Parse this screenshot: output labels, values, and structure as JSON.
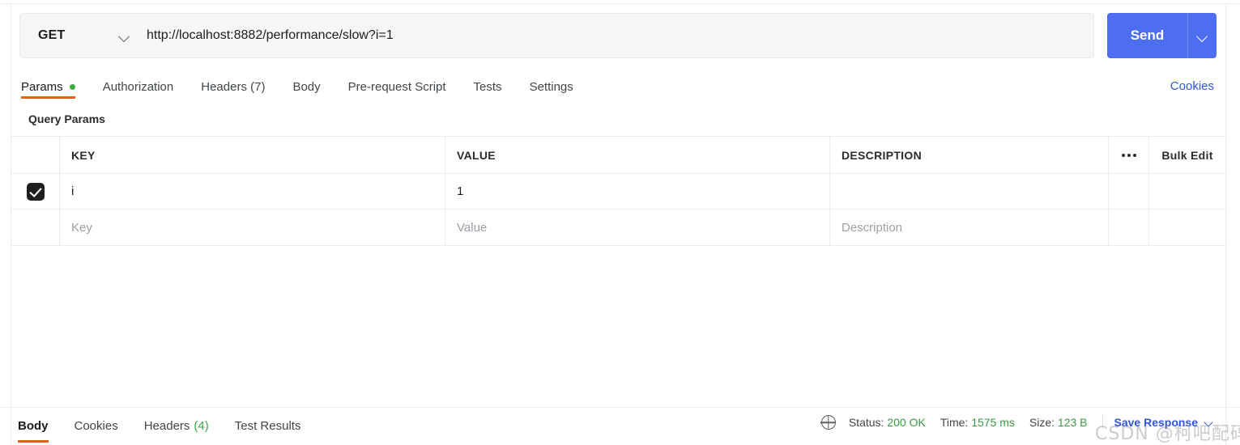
{
  "request": {
    "method": "GET",
    "url": "http://localhost:8882/performance/slow?i=1",
    "send_label": "Send",
    "send_caret_icon": "chevron-down-icon",
    "method_caret_icon": "chevron-down-icon"
  },
  "request_tabs": {
    "items": [
      {
        "label": "Params",
        "active": true,
        "has_dot": true
      },
      {
        "label": "Authorization",
        "active": false,
        "has_dot": false
      },
      {
        "label": "Headers (7)",
        "active": false,
        "has_dot": false
      },
      {
        "label": "Body",
        "active": false,
        "has_dot": false
      },
      {
        "label": "Pre-request Script",
        "active": false,
        "has_dot": false
      },
      {
        "label": "Tests",
        "active": false,
        "has_dot": false
      },
      {
        "label": "Settings",
        "active": false,
        "has_dot": false
      }
    ],
    "cookies_label": "Cookies"
  },
  "query_params": {
    "section_title": "Query Params",
    "columns": {
      "key": "KEY",
      "value": "VALUE",
      "description": "DESCRIPTION"
    },
    "more_icon": "ellipsis-icon",
    "bulk_edit_label": "Bulk Edit",
    "rows": [
      {
        "checked": true,
        "key": "i",
        "value": "1",
        "description": "",
        "is_placeholder": false
      },
      {
        "checked": false,
        "key": "Key",
        "value": "Value",
        "description": "Description",
        "is_placeholder": true
      }
    ]
  },
  "response": {
    "tabs": [
      {
        "label": "Body",
        "count": "",
        "active": true
      },
      {
        "label": "Cookies",
        "count": "",
        "active": false
      },
      {
        "label": "Headers",
        "count": "(4)",
        "active": false
      },
      {
        "label": "Test Results",
        "count": "",
        "active": false
      }
    ],
    "globe_icon": "globe-icon",
    "status_label": "Status:",
    "status_value": "200 OK",
    "time_label": "Time:",
    "time_value": "1575 ms",
    "size_label": "Size:",
    "size_value": "123 B",
    "save_response_label": "Save Response",
    "save_response_caret_icon": "chevron-down-icon"
  },
  "watermark": {
    "text": "CSDN @柯吧配码"
  },
  "colors": {
    "accent_orange": "#e2601a",
    "brand_blue": "#4e6ef2",
    "link_blue": "#2f56d9",
    "status_green": "#3a9a41"
  }
}
